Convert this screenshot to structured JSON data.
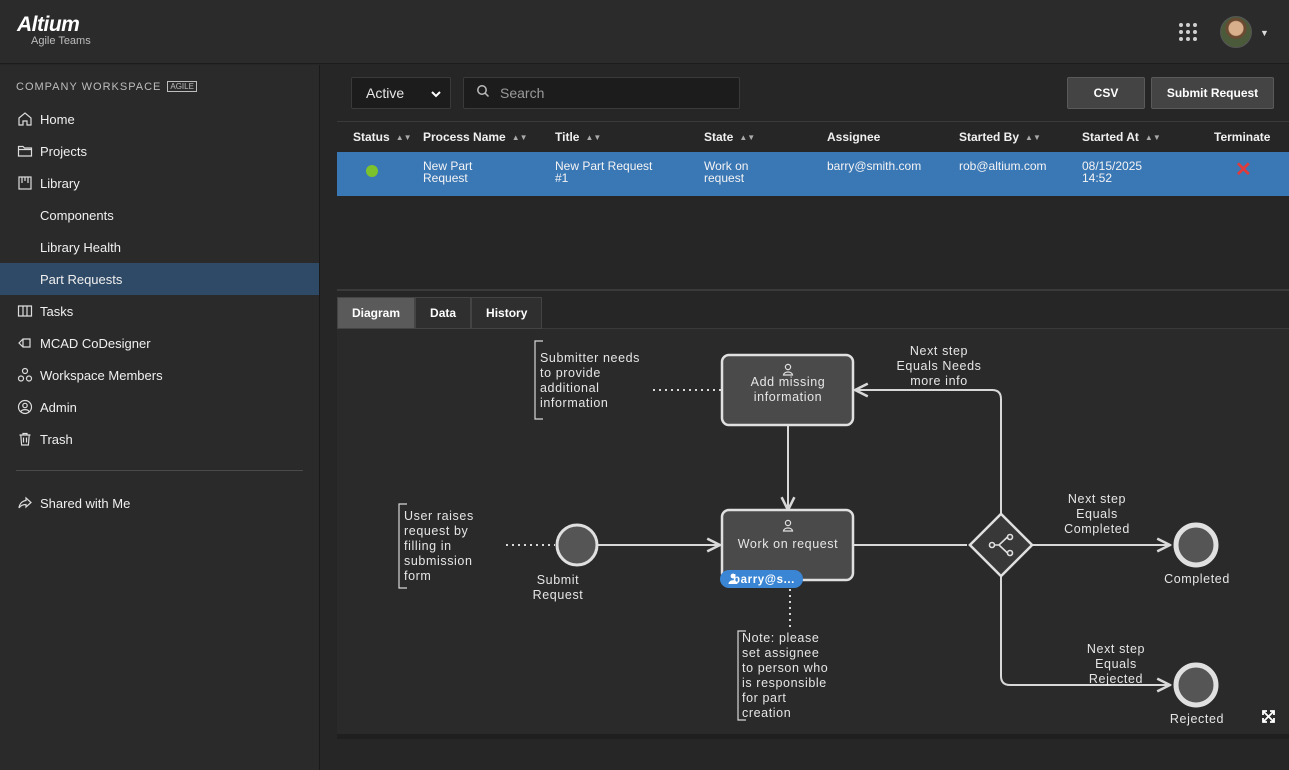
{
  "app": {
    "brand": "Altium",
    "subtitle": "Agile Teams"
  },
  "sidebar": {
    "workspace_title": "COMPANY WORKSPACE",
    "workspace_badge": "AGILE",
    "items": [
      {
        "label": "Home",
        "icon": "home-icon"
      },
      {
        "label": "Projects",
        "icon": "folder-icon"
      },
      {
        "label": "Library",
        "icon": "library-icon"
      },
      {
        "label": "Components",
        "icon": ""
      },
      {
        "label": "Library Health",
        "icon": ""
      },
      {
        "label": "Part Requests",
        "icon": "",
        "active": true
      },
      {
        "label": "Tasks",
        "icon": "tasks-icon"
      },
      {
        "label": "MCAD CoDesigner",
        "icon": "mcad-icon"
      },
      {
        "label": "Workspace Members",
        "icon": "members-icon"
      },
      {
        "label": "Admin",
        "icon": "admin-icon"
      },
      {
        "label": "Trash",
        "icon": "trash-icon"
      }
    ],
    "shared": {
      "label": "Shared with Me",
      "icon": "share-icon"
    }
  },
  "toolbar": {
    "filter_value": "Active",
    "search_placeholder": "Search",
    "csv_label": "CSV",
    "submit_label": "Submit Request"
  },
  "table": {
    "headers": [
      "Status",
      "Process Name",
      "Title",
      "State",
      "Assignee",
      "Started By",
      "Started At",
      "Terminate"
    ],
    "rows": [
      {
        "status_color": "#7cc22c",
        "process_line1": "New Part",
        "process_line2": "Request",
        "title_line1": "New Part Request",
        "title_line2": "#1",
        "state_line1": "Work on",
        "state_line2": "request",
        "assignee": "barry@smith.com",
        "started_by": "rob@altium.com",
        "started_at_line1": "08/15/2025",
        "started_at_line2": "14:52",
        "terminate": "✕"
      }
    ]
  },
  "tabs": [
    "Diagram",
    "Data",
    "History"
  ],
  "diagram": {
    "note_top": [
      "Submitter needs",
      "to provide",
      "additional",
      "information"
    ],
    "note_left": [
      "User raises",
      "request by",
      "filling in",
      "submission",
      "form"
    ],
    "note_bottom": [
      "Note: please",
      "set assignee",
      "to person who",
      "is responsible",
      "for part",
      "creation"
    ],
    "add_missing": [
      "Add missing",
      "information"
    ],
    "work_on": "Work on request",
    "assignee_pill": "barry@s...",
    "start_label": [
      "Submit",
      "Request"
    ],
    "needs_label": [
      "Next step",
      "Equals Needs",
      "more info"
    ],
    "completed_edge": [
      "Next step",
      "Equals",
      "Completed"
    ],
    "rejected_edge": [
      "Next step",
      "Equals",
      "Rejected"
    ],
    "completed_label": "Completed",
    "rejected_label": "Rejected"
  },
  "colors": {
    "accent": "#3a77b5",
    "active_nav": "#2f4a66",
    "terminate": "#e23b3b",
    "assignee_pill": "#3a86d4"
  }
}
